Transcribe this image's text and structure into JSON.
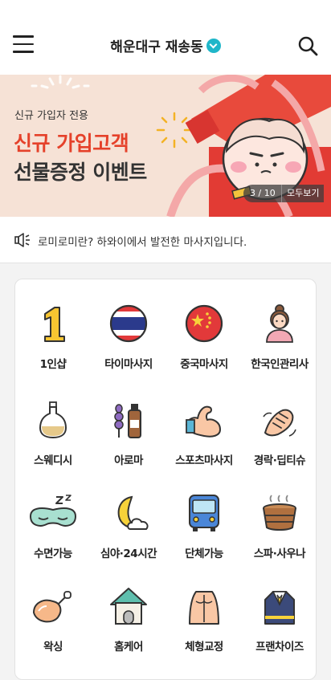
{
  "header": {
    "title": "해운대구 재송동"
  },
  "banner": {
    "subtitle": "신규 가입자 전용",
    "headline1": "신규 가입고객",
    "headline2": "선물증정 이벤트",
    "counter": "3 / 10",
    "view_all": "모두보기"
  },
  "notice": {
    "text": "로미로미란? 하와이에서 발전한 마사지입니다."
  },
  "categories": [
    {
      "label": "1인샵"
    },
    {
      "label": "타이마사지"
    },
    {
      "label": "중국마사지"
    },
    {
      "label": "한국인관리사"
    },
    {
      "label": "스웨디시"
    },
    {
      "label": "아로마"
    },
    {
      "label": "스포츠마사지"
    },
    {
      "label": "경락·딥티슈"
    },
    {
      "label": "수면가능"
    },
    {
      "label": "심야·24시간"
    },
    {
      "label": "단체가능"
    },
    {
      "label": "스파·사우나"
    },
    {
      "label": "왁싱"
    },
    {
      "label": "홈케어"
    },
    {
      "label": "체형교정"
    },
    {
      "label": "프랜차이즈"
    }
  ],
  "colors": {
    "accent": "#1fb6c9",
    "headline_red": "#e5412a",
    "banner_bg": "#f6e2d6"
  }
}
